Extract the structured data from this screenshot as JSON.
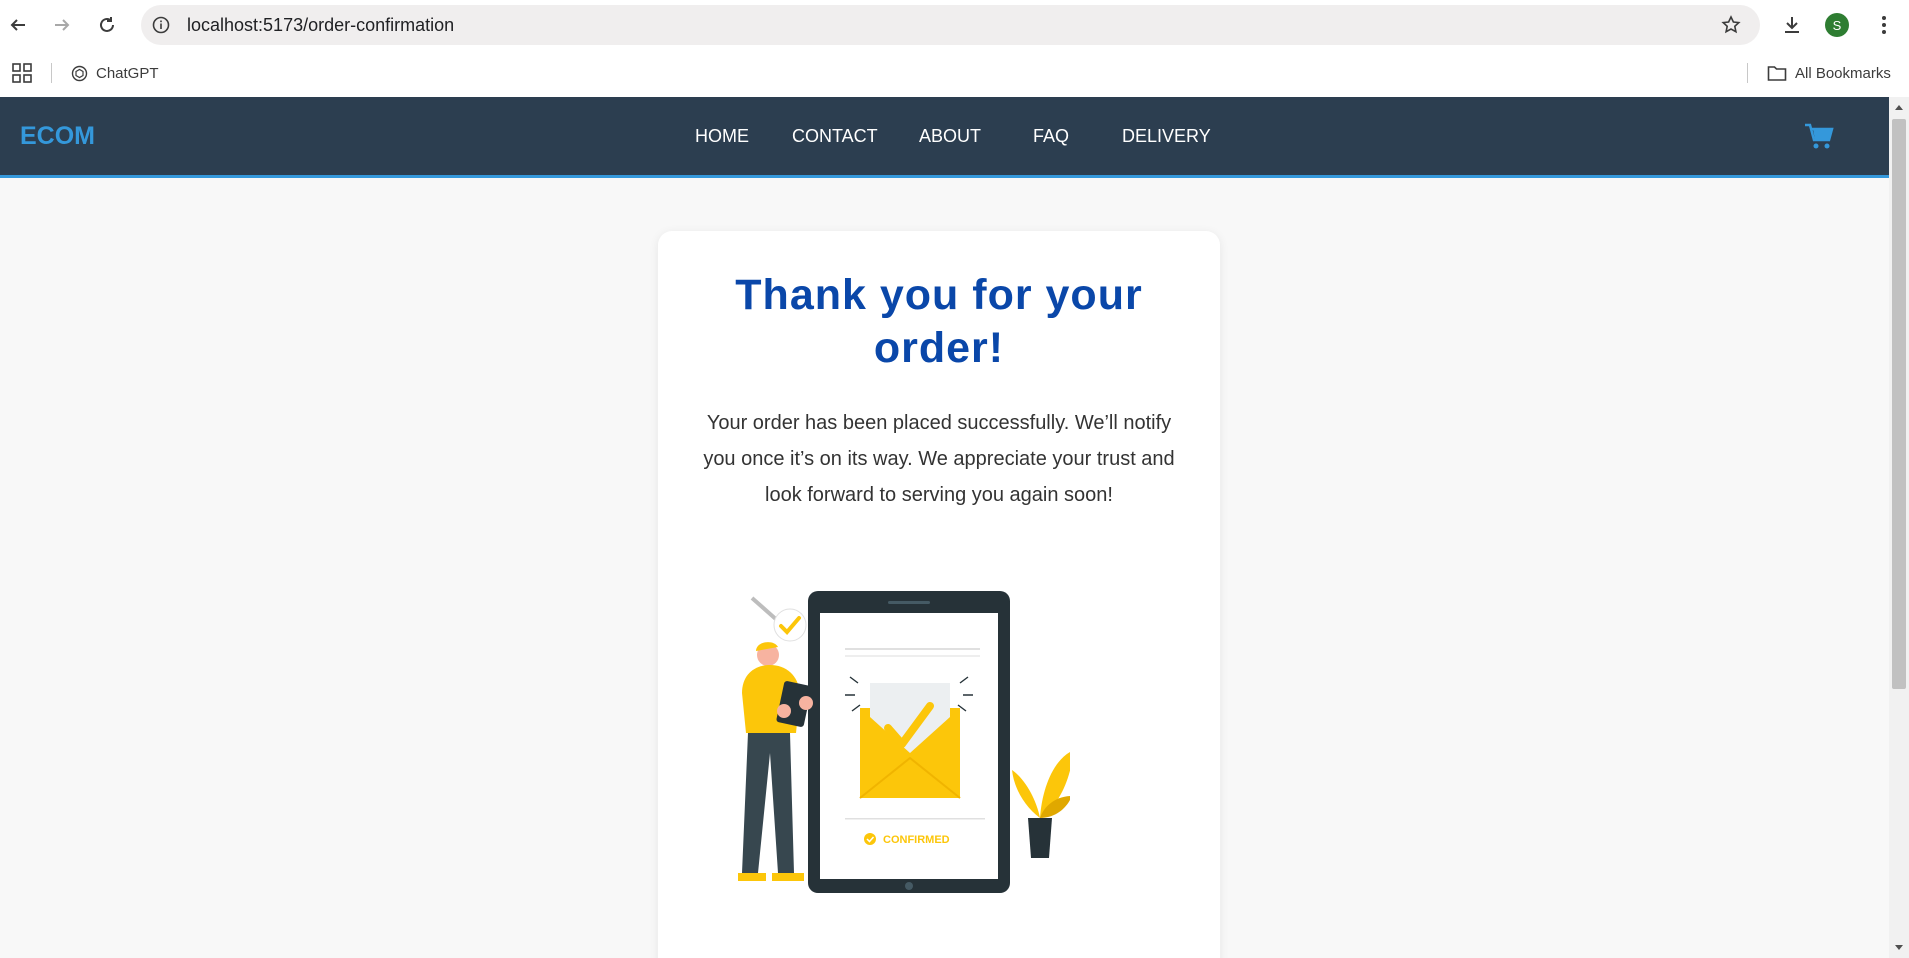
{
  "browser": {
    "url": "localhost:5173/order-confirmation",
    "profile_initial": "S",
    "bookmarks": [
      {
        "label": "ChatGPT",
        "icon": "chatgpt-icon"
      }
    ],
    "all_bookmarks_label": "All Bookmarks"
  },
  "site": {
    "brand": "ECOM",
    "nav": [
      "HOME",
      "CONTACT",
      "ABOUT",
      "FAQ",
      "DELIVERY"
    ],
    "cart_icon": "cart-icon",
    "colors": {
      "nav_bg": "#2c3e50",
      "accent": "#3498db",
      "title": "#0a47a9",
      "illustration_yellow": "#fcc60a",
      "illustration_dark": "#263238"
    }
  },
  "confirmation": {
    "title": "Thank you for your order!",
    "message": "Your order has been placed successfully. We’ll notify you once it’s on its way. We appreciate your trust and look forward to serving you again soon!",
    "illustration": {
      "badge_text": "CONFIRMED"
    }
  }
}
